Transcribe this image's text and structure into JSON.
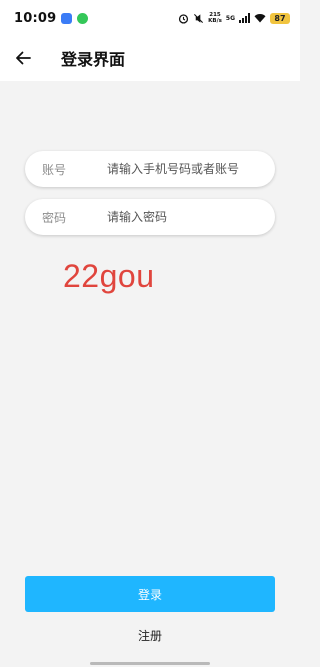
{
  "status_bar": {
    "time": "10:09",
    "speed_value": "215",
    "speed_unit": "KB/s",
    "network": "5G",
    "battery": "87",
    "app_icon_colors": [
      "#3b7cf6",
      "#34c759"
    ]
  },
  "header": {
    "back_icon": "arrow-left-icon",
    "title": "登录界面"
  },
  "form": {
    "account": {
      "label": "账号",
      "placeholder": "请输入手机号码或者账号",
      "value": ""
    },
    "password": {
      "label": "密码",
      "placeholder": "请输入密码",
      "value": ""
    }
  },
  "watermark": "22gou",
  "actions": {
    "login_label": "登录",
    "register_label": "注册"
  },
  "colors": {
    "accent": "#1fb6ff",
    "watermark": "#e0453d",
    "background": "#f3f3f3"
  }
}
